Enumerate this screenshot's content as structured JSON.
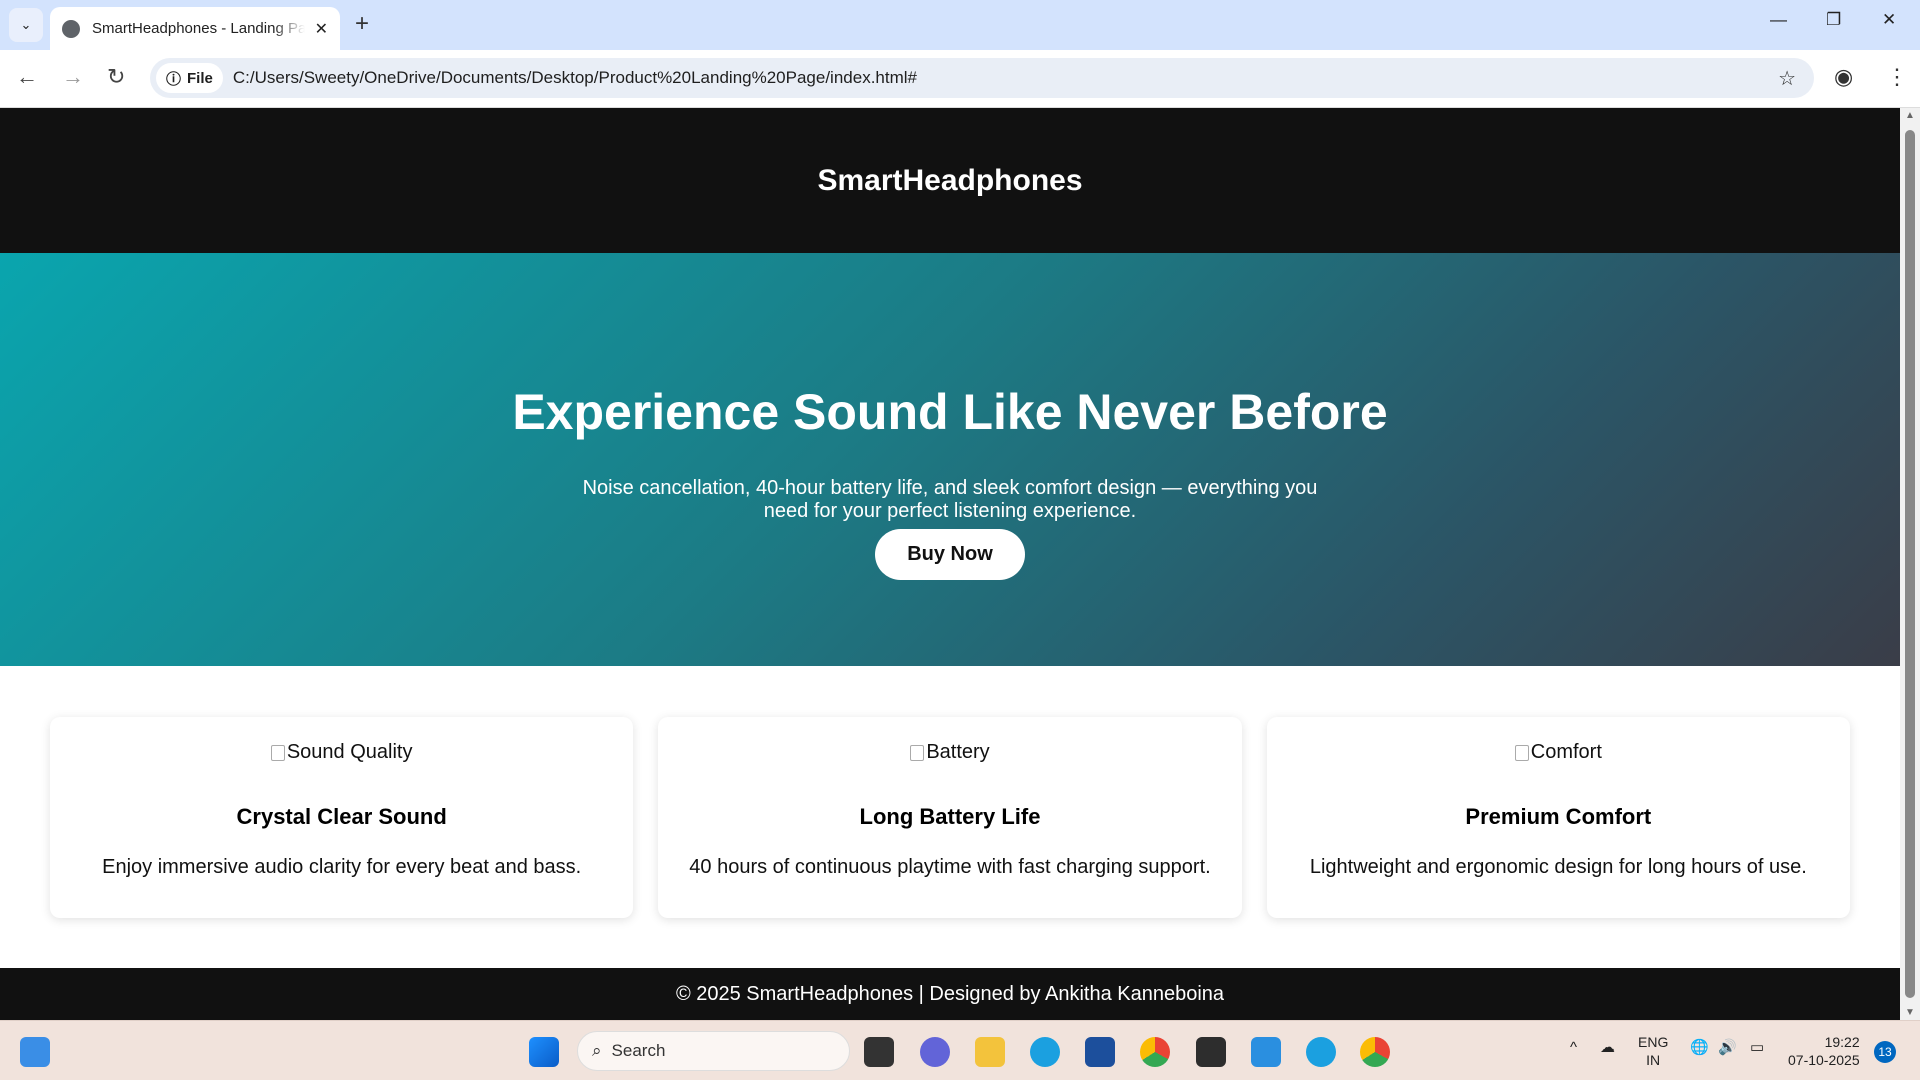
{
  "browser": {
    "tab_title": "SmartHeadphones - Landing Page",
    "url_chip": "File",
    "url": "C:/Users/Sweety/OneDrive/Documents/Desktop/Product%20Landing%20Page/index.html#"
  },
  "site": {
    "brand": "SmartHeadphones",
    "hero": {
      "title": "Experience Sound Like Never Before",
      "subtitle": "Noise cancellation, 40-hour battery life, and sleek comfort design — everything you need for your perfect listening experience.",
      "cta": "Buy Now"
    },
    "features": [
      {
        "img_alt": "Sound Quality",
        "title": "Crystal Clear Sound",
        "text": "Enjoy immersive audio clarity for every beat and bass."
      },
      {
        "img_alt": "Battery",
        "title": "Long Battery Life",
        "text": "40 hours of continuous playtime with fast charging support."
      },
      {
        "img_alt": "Comfort",
        "title": "Premium Comfort",
        "text": "Lightweight and ergonomic design for long hours of use."
      }
    ],
    "footer": "© 2025 SmartHeadphones | Designed by Ankitha Kanneboina"
  },
  "taskbar": {
    "search_placeholder": "Search",
    "lang": "ENG",
    "region": "IN",
    "time": "19:22",
    "date": "07-10-2025",
    "notifications": "13"
  }
}
